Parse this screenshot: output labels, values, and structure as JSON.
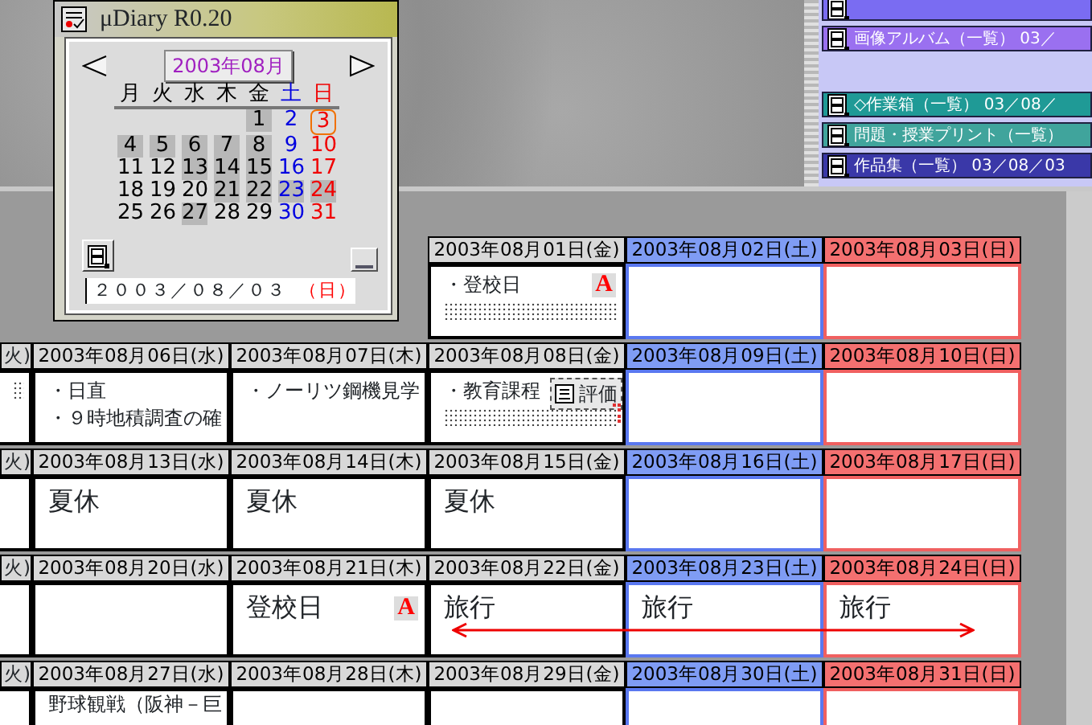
{
  "panel": {
    "groups": [
      {
        "items": [
          {
            "color": "#7a6cf2"
          },
          {
            "label": "画像アルバム（一覧） 03／",
            "color": "#9a70f0"
          }
        ]
      },
      {
        "items": [
          {
            "label": "◇作業箱（一覧） 03／08／",
            "color": "#1f9a96"
          },
          {
            "label": "問題・授業プリント（一覧）",
            "color": "#40a49c"
          },
          {
            "label": "作品集（一覧） 03／08／03",
            "color": "#3a38a8"
          }
        ]
      }
    ]
  },
  "diary_window": {
    "title": "μDiary R0.20",
    "month": "2003年08月",
    "weekdays": [
      "月",
      "火",
      "水",
      "木",
      "金",
      "土",
      "日"
    ],
    "weeks": [
      [
        {
          "day": "1",
          "highlighted": true,
          "today": false
        },
        {
          "day": "2",
          "highlighted": false,
          "today": false
        },
        {
          "day": "3",
          "highlighted": false,
          "today": true
        }
      ],
      [
        {
          "day": "4",
          "highlighted": true,
          "today": false
        },
        {
          "day": "5",
          "highlighted": true,
          "today": false
        },
        {
          "day": "6",
          "highlighted": true,
          "today": false
        },
        {
          "day": "7",
          "highlighted": true,
          "today": false
        },
        {
          "day": "8",
          "highlighted": true,
          "today": false
        },
        {
          "day": "9",
          "highlighted": false,
          "today": false
        },
        {
          "day": "10",
          "highlighted": false,
          "today": false
        }
      ],
      [
        {
          "day": "11",
          "highlighted": false,
          "today": false
        },
        {
          "day": "12",
          "highlighted": false,
          "today": false
        },
        {
          "day": "13",
          "highlighted": true,
          "today": false
        },
        {
          "day": "14",
          "highlighted": true,
          "today": false
        },
        {
          "day": "15",
          "highlighted": true,
          "today": false
        },
        {
          "day": "16",
          "highlighted": false,
          "today": false
        },
        {
          "day": "17",
          "highlighted": false,
          "today": false
        }
      ],
      [
        {
          "day": "18",
          "highlighted": false,
          "today": false
        },
        {
          "day": "19",
          "highlighted": false,
          "today": false
        },
        {
          "day": "20",
          "highlighted": false,
          "today": false
        },
        {
          "day": "21",
          "highlighted": true,
          "today": false
        },
        {
          "day": "22",
          "highlighted": true,
          "today": false
        },
        {
          "day": "23",
          "highlighted": true,
          "today": false
        },
        {
          "day": "24",
          "highlighted": true,
          "today": false
        }
      ],
      [
        {
          "day": "25",
          "highlighted": false,
          "today": false
        },
        {
          "day": "26",
          "highlighted": false,
          "today": false
        },
        {
          "day": "27",
          "highlighted": true,
          "today": false
        },
        {
          "day": "28",
          "highlighted": false,
          "today": false
        },
        {
          "day": "29",
          "highlighted": false,
          "today": false
        },
        {
          "day": "30",
          "highlighted": false,
          "today": false
        },
        {
          "day": "31",
          "highlighted": false,
          "today": false
        }
      ]
    ],
    "date_field": {
      "value": "２００３／０８／０３",
      "weekday": "（日）"
    }
  },
  "calendar": {
    "weeks": [
      {
        "days": [
          {
            "header": "2003年08月01日(金)",
            "kind": "weekday",
            "entries": [
              {
                "kind": "text",
                "text": "・登校日",
                "badge": "A"
              },
              {
                "kind": "dotted"
              }
            ]
          },
          {
            "header": "2003年08月02日(土)",
            "kind": "saturday"
          },
          {
            "header": "2003年08月03日(日)",
            "kind": "sunday"
          }
        ]
      },
      {
        "cut_header": "火)",
        "cut_entries": [
          {
            "kind": "dotted"
          }
        ],
        "days": [
          {
            "header": "2003年08月06日(水)",
            "kind": "weekday",
            "entries": [
              {
                "kind": "text",
                "text": "・日直"
              },
              {
                "kind": "text",
                "text": "・９時地積調査の確"
              }
            ]
          },
          {
            "header": "2003年08月07日(木)",
            "kind": "weekday",
            "entries": [
              {
                "kind": "text",
                "text": "・ノーリツ鋼機見学"
              }
            ]
          },
          {
            "header": "2003年08月08日(金)",
            "kind": "weekday",
            "entries": [
              {
                "kind": "text",
                "text": "・教育課程",
                "overlay": "評価"
              },
              {
                "kind": "dotted",
                "corner": true
              }
            ]
          },
          {
            "header": "2003年08月09日(土)",
            "kind": "saturday"
          },
          {
            "header": "2003年08月10日(日)",
            "kind": "sunday"
          }
        ]
      },
      {
        "cut_header": "火)",
        "days": [
          {
            "header": "2003年08月13日(水)",
            "kind": "weekday",
            "entries": [
              {
                "kind": "note",
                "text": "夏休"
              }
            ]
          },
          {
            "header": "2003年08月14日(木)",
            "kind": "weekday",
            "entries": [
              {
                "kind": "note",
                "text": "夏休"
              }
            ]
          },
          {
            "header": "2003年08月15日(金)",
            "kind": "weekday",
            "entries": [
              {
                "kind": "note",
                "text": "夏休"
              }
            ]
          },
          {
            "header": "2003年08月16日(土)",
            "kind": "saturday"
          },
          {
            "header": "2003年08月17日(日)",
            "kind": "sunday"
          }
        ]
      },
      {
        "cut_header": "火)",
        "arrow": true,
        "days": [
          {
            "header": "2003年08月20日(水)",
            "kind": "weekday"
          },
          {
            "header": "2003年08月21日(木)",
            "kind": "weekday",
            "entries": [
              {
                "kind": "note",
                "text": "登校日",
                "badge": "A"
              }
            ]
          },
          {
            "header": "2003年08月22日(金)",
            "kind": "weekday",
            "entries": [
              {
                "kind": "note",
                "text": "旅行"
              }
            ]
          },
          {
            "header": "2003年08月23日(土)",
            "kind": "saturday",
            "entries": [
              {
                "kind": "note",
                "text": "旅行"
              }
            ]
          },
          {
            "header": "2003年08月24日(日)",
            "kind": "sunday",
            "entries": [
              {
                "kind": "note",
                "text": "旅行"
              }
            ]
          }
        ]
      },
      {
        "cut_header": "火)",
        "days": [
          {
            "header": "2003年08月27日(水)",
            "kind": "weekday",
            "entries": [
              {
                "kind": "text",
                "text": "野球観戦（阪神－巨"
              }
            ]
          },
          {
            "header": "2003年08月28日(木)",
            "kind": "weekday"
          },
          {
            "header": "2003年08月29日(金)",
            "kind": "weekday"
          },
          {
            "header": "2003年08月30日(土)",
            "kind": "saturday"
          },
          {
            "header": "2003年08月31日(日)",
            "kind": "sunday"
          }
        ]
      }
    ]
  }
}
